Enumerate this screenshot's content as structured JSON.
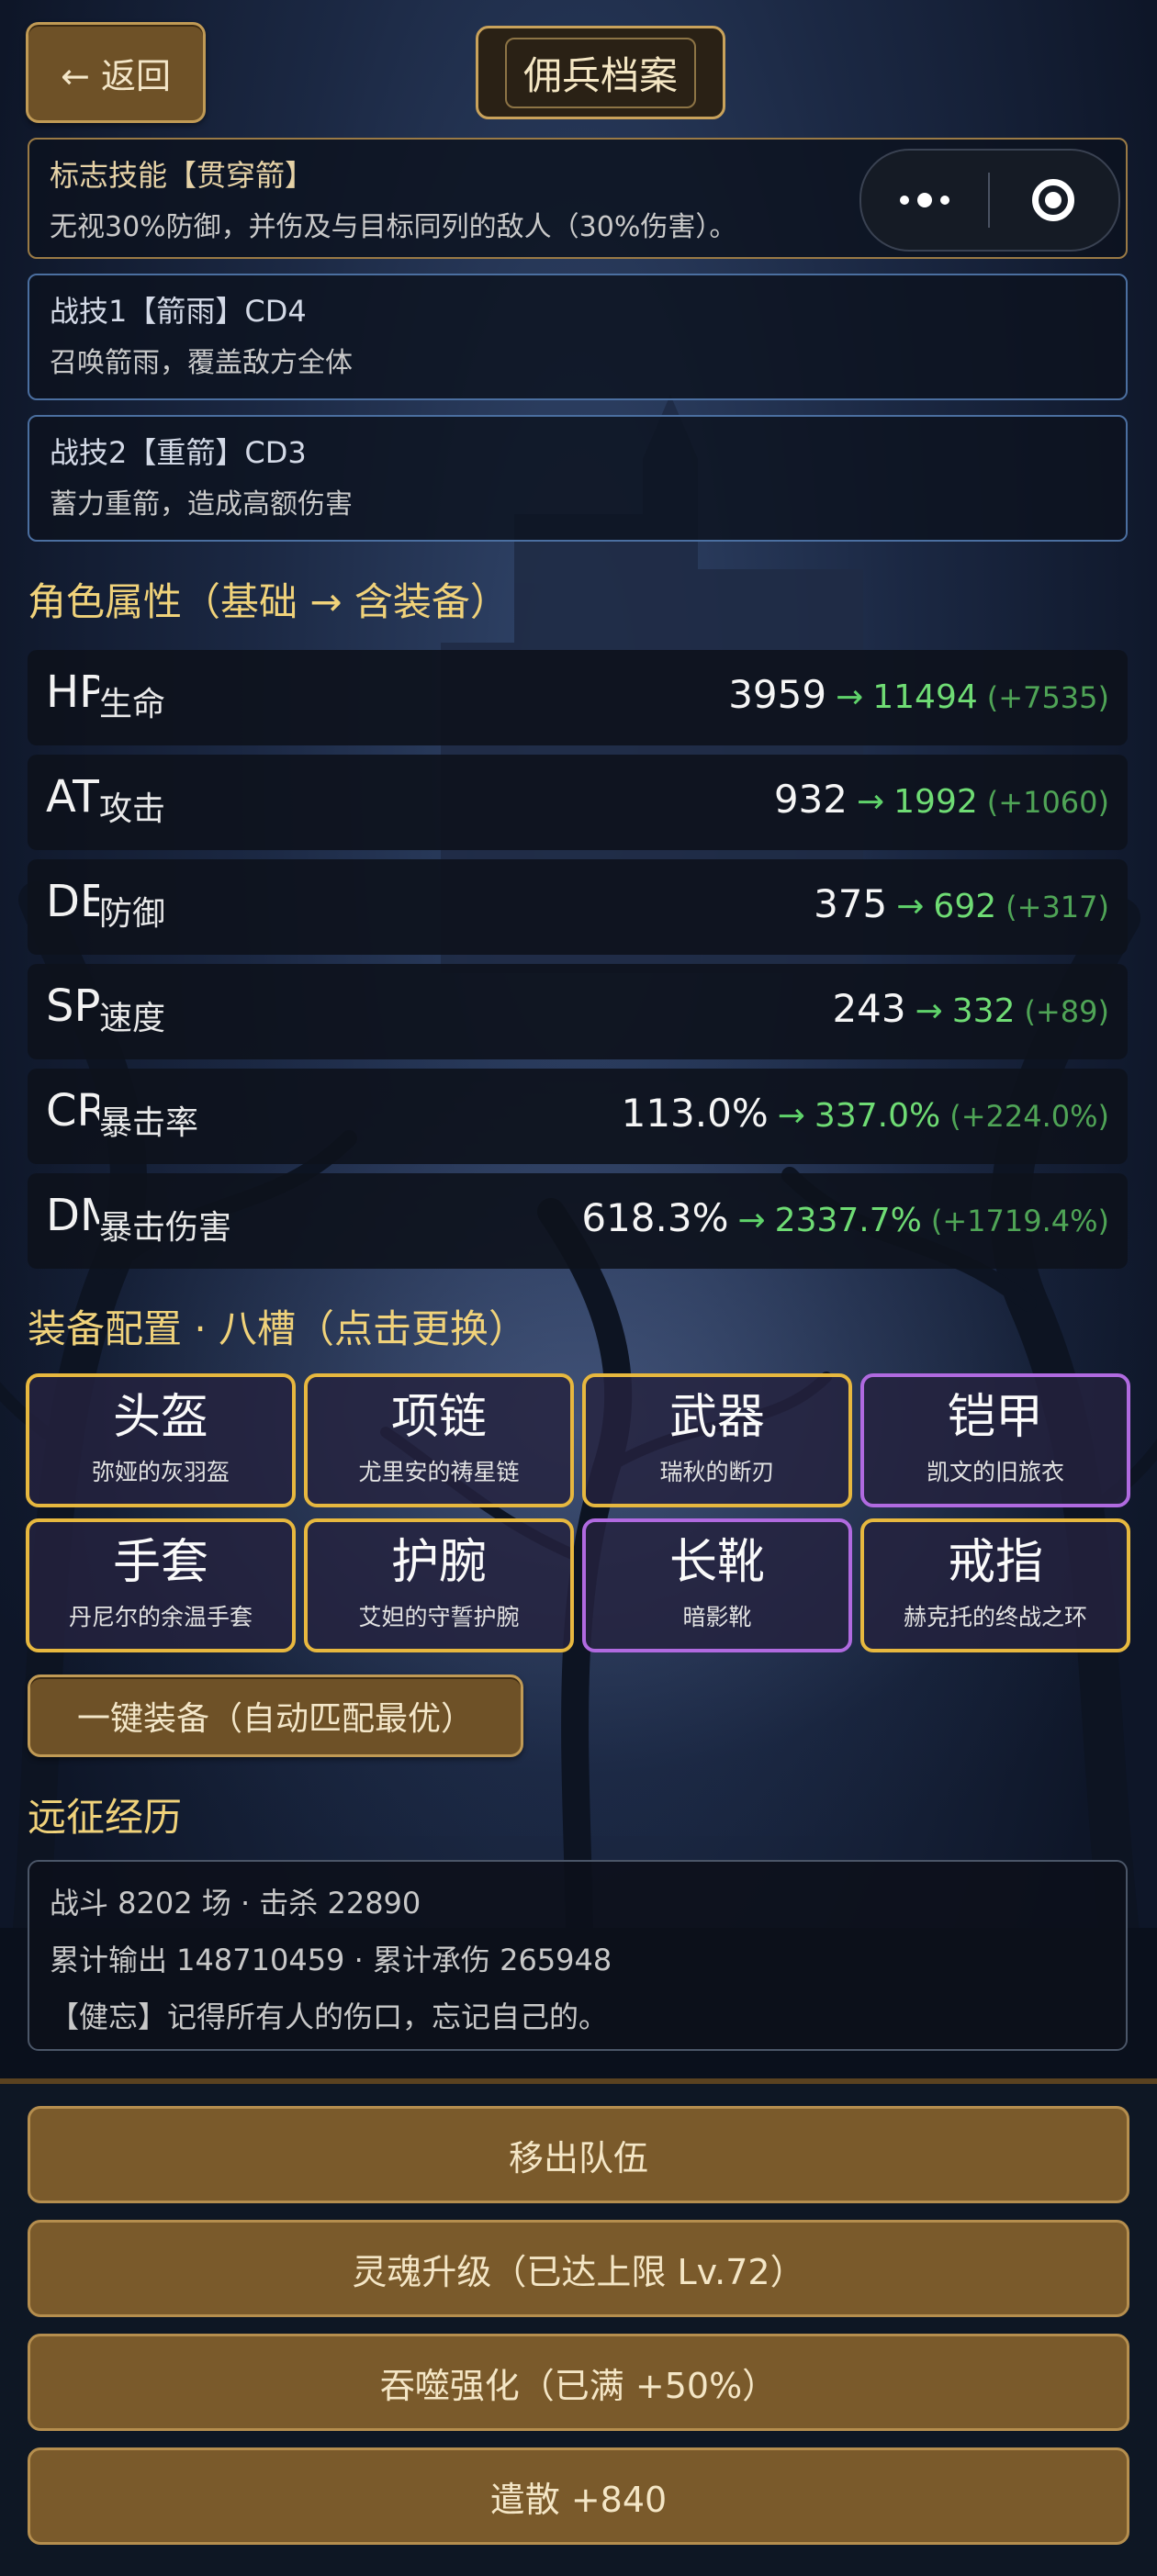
{
  "header": {
    "back_label": "← 返回",
    "title": "佣兵档案"
  },
  "skills": {
    "signature": {
      "name": "标志技能【贯穿箭】",
      "desc": "无视30%防御，并伤及与目标同列的敌人（30%伤害）。"
    },
    "skill1": {
      "name": "战技1【箭雨】CD4",
      "desc": "召唤箭雨，覆盖敌方全体"
    },
    "skill2": {
      "name": "战技2【重箭】CD3",
      "desc": "蓄力重箭，造成高额伤害"
    }
  },
  "attributes": {
    "title": "角色属性（基础 → 含装备）",
    "arrow": "→",
    "rows": [
      {
        "abbr": "HP",
        "name": "生命",
        "base": "3959",
        "final": "11494",
        "delta": "(+7535)"
      },
      {
        "abbr": "ATK",
        "name": "攻击",
        "base": "932",
        "final": "1992",
        "delta": "(+1060)"
      },
      {
        "abbr": "DEF",
        "name": "防御",
        "base": "375",
        "final": "692",
        "delta": "(+317)"
      },
      {
        "abbr": "SPD",
        "name": "速度",
        "base": "243",
        "final": "332",
        "delta": "(+89)"
      },
      {
        "abbr": "CRT",
        "name": "暴击率",
        "base": "113.0%",
        "final": "337.0%",
        "delta": "(+224.0%)"
      },
      {
        "abbr": "DMG",
        "name": "暴击伤害",
        "base": "618.3%",
        "final": "2337.7%",
        "delta": "(+1719.4%)"
      }
    ]
  },
  "equipment": {
    "title": "装备配置 · 八槽（点击更换）",
    "slots": [
      {
        "slot": "头盔",
        "item": "弥娅的灰羽盔",
        "rarity": "gold"
      },
      {
        "slot": "项链",
        "item": "尤里安的祷星链",
        "rarity": "gold"
      },
      {
        "slot": "武器",
        "item": "瑞秋的断刃",
        "rarity": "gold"
      },
      {
        "slot": "铠甲",
        "item": "凯文的旧旅衣",
        "rarity": "purple"
      },
      {
        "slot": "手套",
        "item": "丹尼尔的余温手套",
        "rarity": "gold"
      },
      {
        "slot": "护腕",
        "item": "艾妲的守誓护腕",
        "rarity": "gold"
      },
      {
        "slot": "长靴",
        "item": "暗影靴",
        "rarity": "purple"
      },
      {
        "slot": "戒指",
        "item": "赫克托的终战之环",
        "rarity": "gold"
      }
    ],
    "auto_equip_label": "一键装备（自动匹配最优）"
  },
  "history": {
    "title": "远征经历",
    "line1": "战斗 8202 场 · 击杀 22890",
    "line2": "累计输出 148710459 · 累计承伤 265948",
    "line3": "【健忘】记得所有人的伤口，忘记自己的。"
  },
  "actions": {
    "remove": "移出队伍",
    "soul_upgrade": "灵魂升级（已达上限 Lv.72）",
    "devour": "吞噬强化（已满 +50%）",
    "dismiss": "遣散 +840"
  },
  "colors": {
    "gold_border": "#e7b83f",
    "purple_border": "#b06ae0",
    "stat_green": "#6fdc74",
    "section_title": "#f0d27a"
  }
}
